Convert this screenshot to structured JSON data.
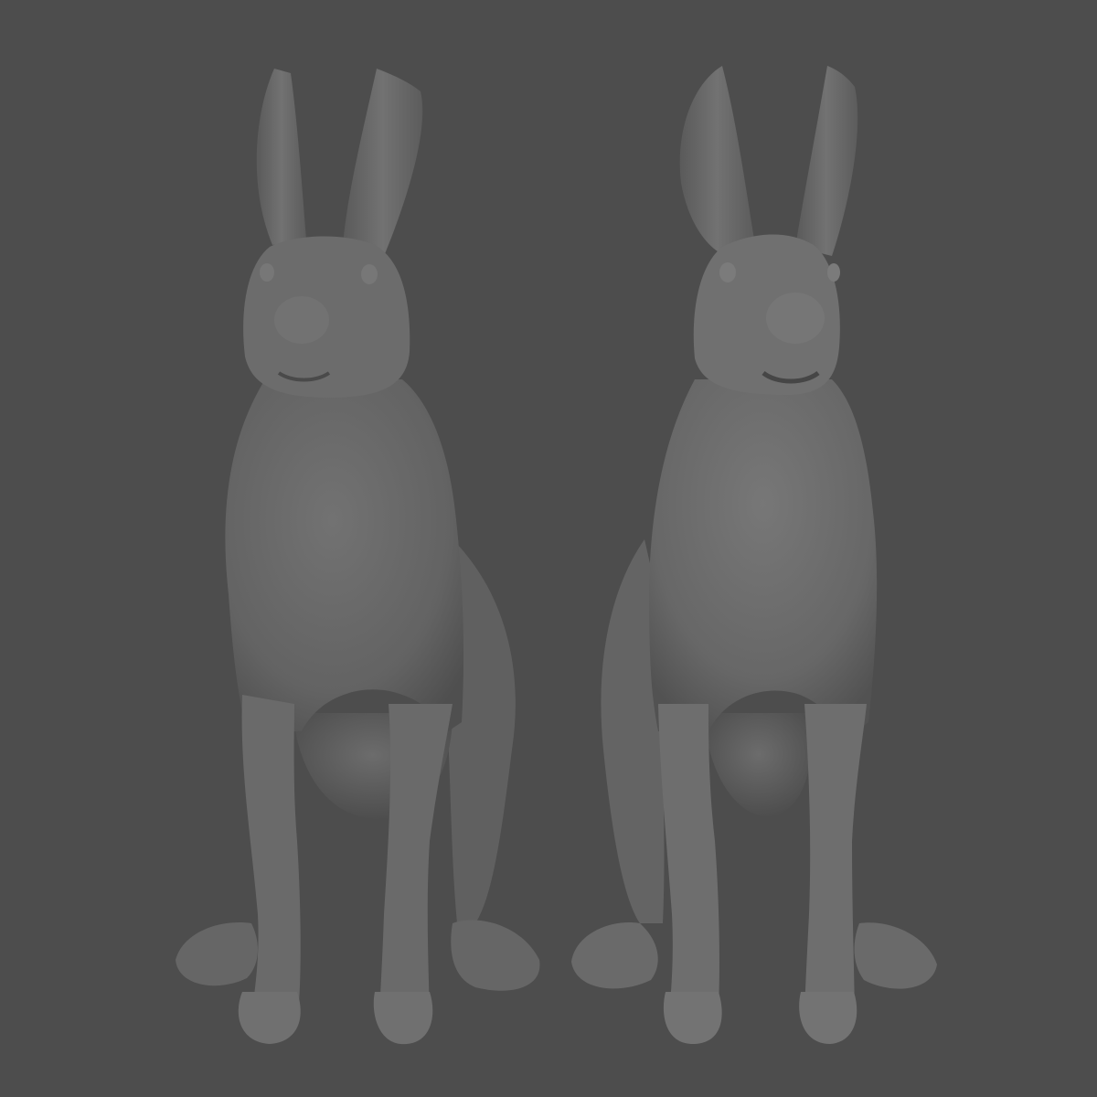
{
  "scene": {
    "background_color": "#4d4d4d",
    "model_color": "#6a6a6a",
    "models": [
      {
        "name": "hare-sculpt-detailed",
        "detail": "high"
      },
      {
        "name": "hare-sculpt-smooth",
        "detail": "low"
      }
    ]
  }
}
